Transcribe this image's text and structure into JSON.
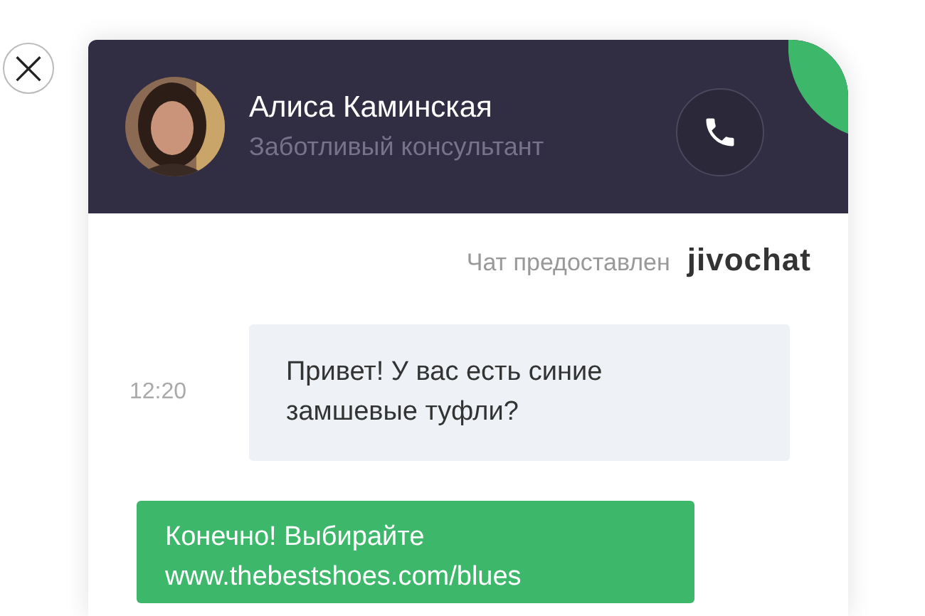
{
  "close_button": {
    "label": "×"
  },
  "header": {
    "name": "Алиса Каминская",
    "role": "Заботливый консультант"
  },
  "provided_by": {
    "text": "Чат предоставлен",
    "brand": "jivochat"
  },
  "messages": [
    {
      "kind": "incoming",
      "time": "12:20",
      "text": "Привет! У вас есть синие замшевые туфли?"
    },
    {
      "kind": "outgoing",
      "text": "Конечно! Выбирайте www.thebestshoes.com/blues"
    }
  ]
}
